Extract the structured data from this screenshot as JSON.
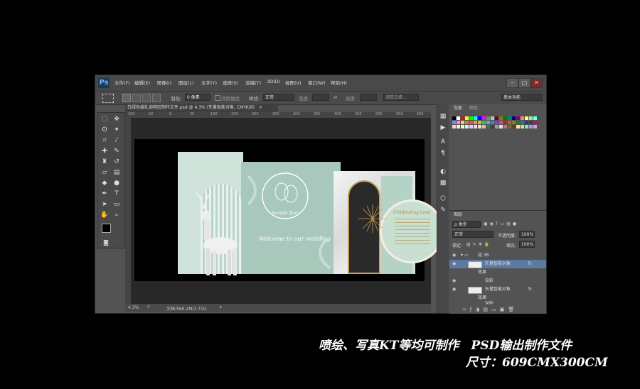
{
  "app": {
    "logo": "Ps",
    "menu": [
      "文件(F)",
      "编辑(E)",
      "图像(I)",
      "图层(L)",
      "文字(Y)",
      "选择(S)",
      "滤镜(T)",
      "3D(D)",
      "视图(V)",
      "窗口(W)",
      "帮助(H)"
    ],
    "window_controls": [
      "–",
      "▢",
      "✕"
    ]
  },
  "options": {
    "feather_label": "羽化:",
    "feather_value": "0 像素",
    "antialias_label": "消除锯齿",
    "style_label": "样式:",
    "style_value": "正常",
    "width_label": "宽度:",
    "height_label": "高度:",
    "refine_edge": "调整边缘...",
    "workspace": "基本功能"
  },
  "document": {
    "tab_title": "白绿色婚礼迎宾区制作文件.psd @ 4.3% (矢量智能对象, CMYK/8)",
    "tab_close": "×",
    "ruler_marks": [
      "100",
      "50",
      "0",
      "50",
      "100",
      "150",
      "200",
      "250",
      "300",
      "350",
      "400",
      "450",
      "500",
      "550",
      "600"
    ],
    "zoom": "4.3%",
    "doc_size": "文档:560.2M/1.71G"
  },
  "artwork": {
    "sample_text": "Sample Text",
    "welcome_text": "Welcome to our wedding",
    "wedding_title": "Welcome to our wedding",
    "sign_title": "Celebrating Love"
  },
  "color_panel": {
    "tabs": [
      "色板",
      "颜色"
    ],
    "swatch_colors": [
      "#000000",
      "#ffffff",
      "#ff0000",
      "#ffff00",
      "#00ff00",
      "#00ffff",
      "#0000ff",
      "#ff00ff",
      "#808080",
      "#c0c0c0",
      "#800000",
      "#808000",
      "#008000",
      "#008080",
      "#000080",
      "#800080",
      "#ff8080",
      "#ffff80",
      "#80ff80",
      "#80ffff",
      "#8080ff",
      "#ff80ff",
      "#ffc080",
      "#c08040",
      "#e05050",
      "#e0a040",
      "#c0c040",
      "#40c040",
      "#40c0c0",
      "#4080e0",
      "#8040e0",
      "#e040a0",
      "#a03030",
      "#a07020",
      "#808020",
      "#208020",
      "#208080",
      "#204080",
      "#602080",
      "#a02060",
      "#ffd0d0",
      "#fff0c0",
      "#e0ffd0",
      "#d0f0ff",
      "#d8d0ff",
      "#ffd0f0",
      "#f0e0c0",
      "#d0c0a0",
      "#606060",
      "#404040",
      "#a0a0a0",
      "#e0e0e0",
      "#b08060",
      "#806040",
      "#604020",
      "#ffe0a0",
      "#c0e0a0",
      "#a0d0e0",
      "#a0a0e0",
      "#e0a0c0"
    ]
  },
  "layers_panel": {
    "tab": "图层",
    "kind_label": "ρ 类型",
    "blend_mode": "正常",
    "opacity_label": "不透明度:",
    "opacity_value": "100%",
    "lock_label": "锁定:",
    "fill_label": "填充:",
    "fill_value": "100%",
    "group_name": "组 36",
    "rows": [
      {
        "name": "矢量智能对象",
        "fx": "fx"
      },
      {
        "name": "效果"
      },
      {
        "name": "投影"
      },
      {
        "name": "矢量智能对象",
        "fx": "fx"
      },
      {
        "name": "效果"
      },
      {
        "name": "投影"
      }
    ]
  },
  "caption": {
    "line1": "喷绘、写真KT等均可制作　PSD输出制作文件",
    "line2": "尺寸：609CMX300CM"
  }
}
